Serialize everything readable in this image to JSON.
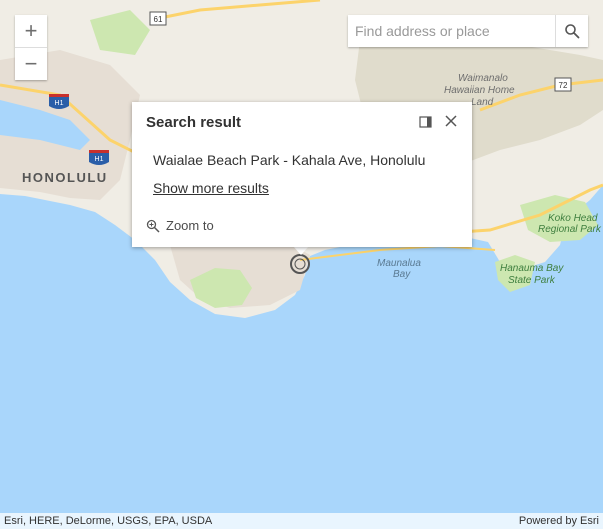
{
  "map": {
    "place_labels": {
      "honolulu": "HONOLULU",
      "waimanalo": "Waimanalo Hawaiian Home Land",
      "maunalua": "Maunalua Bay",
      "kokohead": "Koko Head Regional Park",
      "hanauma": "Hanauma Bay State Park"
    },
    "shields": {
      "h1_a": "H1",
      "h1_b": "H1",
      "r61": "61",
      "r72": "72"
    },
    "colors": {
      "water": "#a9d6fb",
      "land": "#f0ede5",
      "urban": "#e8e1d8",
      "park": "#cde7b0",
      "highway": "#fcd36b",
      "hills": "#e0dccc"
    }
  },
  "zoom": {
    "in_label": "+",
    "out_label": "−"
  },
  "search": {
    "placeholder": "Find address or place",
    "icon": "search-icon"
  },
  "popup": {
    "title": "Search result",
    "result": "Waialae Beach Park - Kahala Ave, Honolulu",
    "show_more": "Show more results",
    "zoom_to": "Zoom to"
  },
  "attribution": {
    "sources": "Esri, HERE, DeLorme, USGS, EPA, USDA",
    "powered": "Powered by Esri"
  }
}
